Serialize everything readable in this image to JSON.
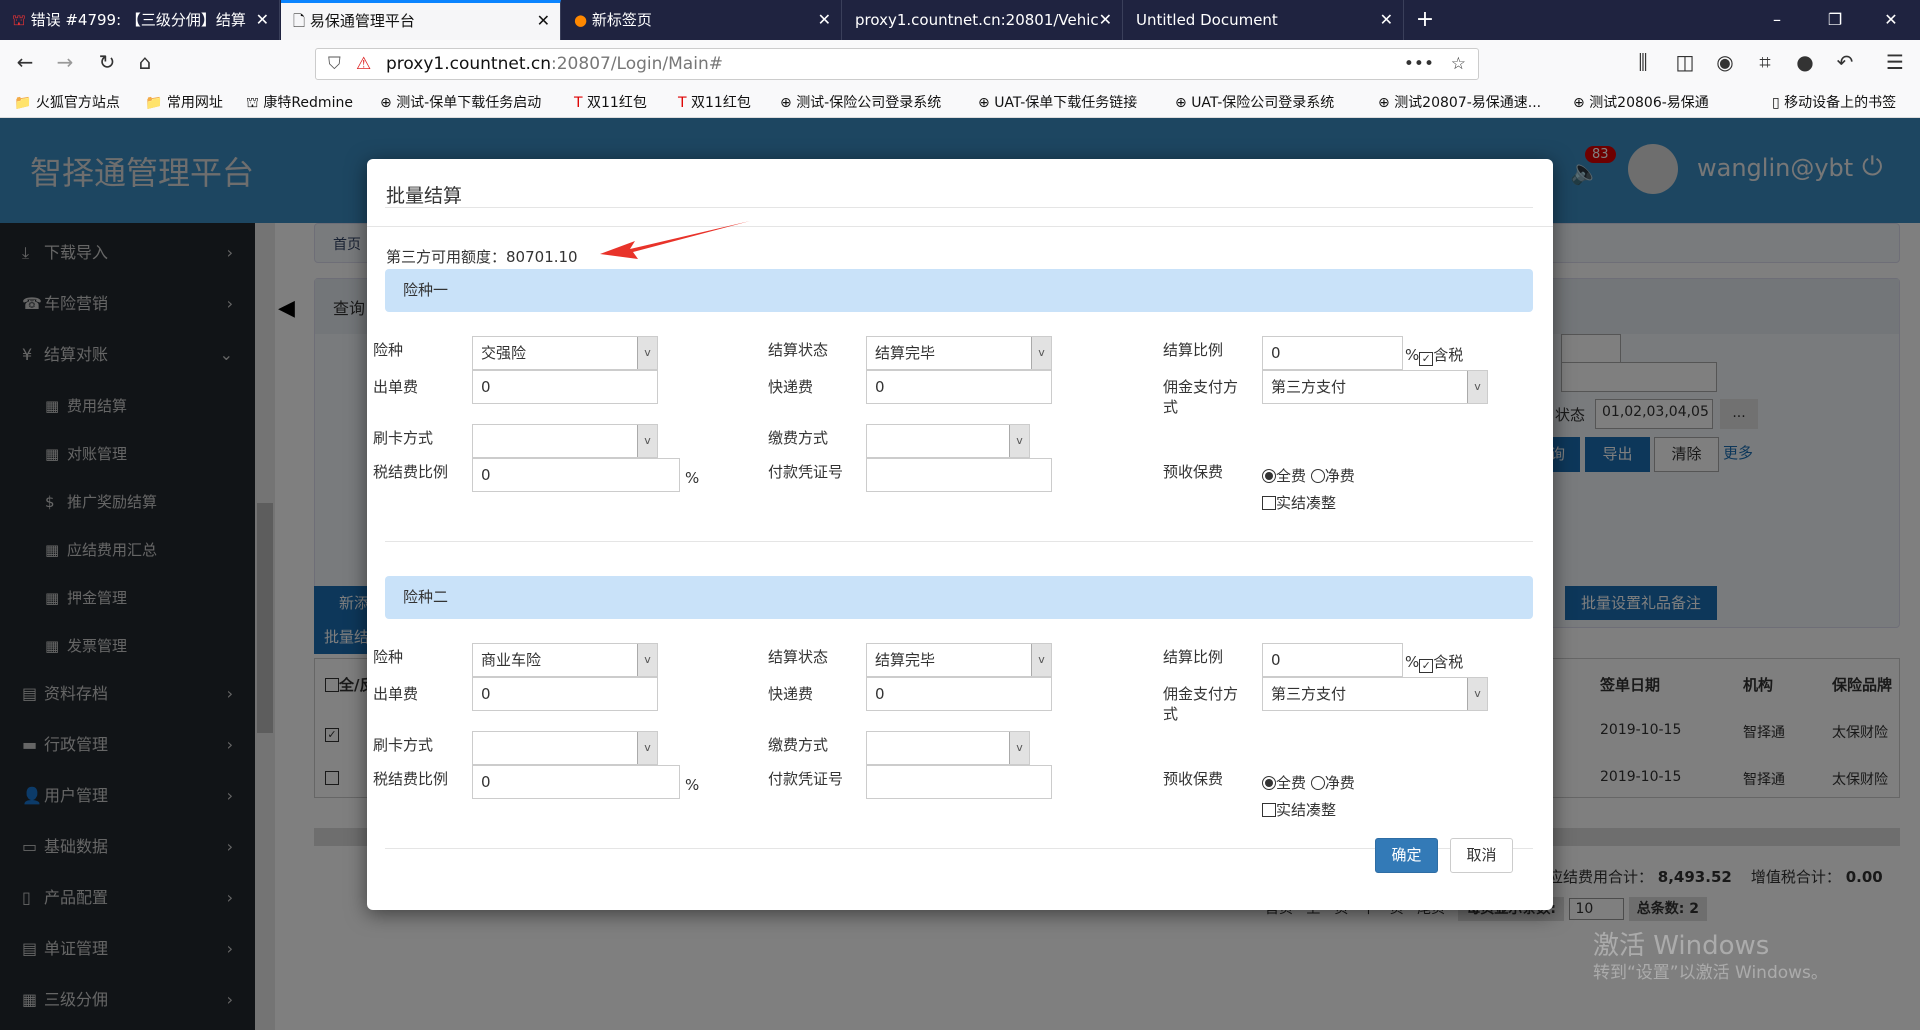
{
  "browser": {
    "tabs": [
      {
        "label": "错误 #4799: 【三级分佣】结算",
        "active": false
      },
      {
        "label": "易保通管理平台",
        "active": true
      },
      {
        "label": "新标签页",
        "active": false
      },
      {
        "label": "proxy1.countnet.cn:20801/Vehic",
        "active": false
      },
      {
        "label": "Untitled Document",
        "active": false
      }
    ],
    "url_host": "proxy1.countnet.cn",
    "url_rest": ":20807/Login/Main#",
    "bookmarks": [
      "火狐官方站点",
      "常用网址",
      "康特Redmine",
      "测试-保单下载任务启动",
      "双11红包",
      "双11红包",
      "测试-保险公司登录系统",
      "UAT-保单下载任务链接",
      "UAT-保险公司登录系统",
      "测试20807-易保通速...",
      "测试20806-易保通",
      "移动设备上的书签"
    ]
  },
  "header": {
    "title": "智择通管理平台",
    "notification_count": "83",
    "username": "wanglin@ybt"
  },
  "sidebar": {
    "items": [
      {
        "label": "下载导入",
        "icon": "download-icon"
      },
      {
        "label": "车险营销",
        "icon": "phone-icon"
      },
      {
        "label": "结算对账",
        "icon": "yen-icon",
        "expanded": true
      },
      {
        "label": "费用结算",
        "icon": "grid-icon",
        "sub": true
      },
      {
        "label": "对账管理",
        "icon": "grid-icon",
        "sub": true
      },
      {
        "label": "推广奖励结算",
        "icon": "dollar-icon",
        "sub": true
      },
      {
        "label": "应结费用汇总",
        "icon": "grid-icon",
        "sub": true
      },
      {
        "label": "押金管理",
        "icon": "grid-icon",
        "sub": true
      },
      {
        "label": "发票管理",
        "icon": "grid-icon",
        "sub": true
      },
      {
        "label": "资料存档",
        "icon": "list-icon"
      },
      {
        "label": "行政管理",
        "icon": "folder-icon"
      },
      {
        "label": "用户管理",
        "icon": "user-icon"
      },
      {
        "label": "基础数据",
        "icon": "drive-icon"
      },
      {
        "label": "产品配置",
        "icon": "book-icon"
      },
      {
        "label": "单证管理",
        "icon": "list-icon"
      },
      {
        "label": "三级分佣",
        "icon": "grid-icon"
      }
    ]
  },
  "background": {
    "breadcrumb": "首页",
    "query_title": "查询",
    "status_label": "状态",
    "status_value": "01,02,03,04,05",
    "ellipsis": "...",
    "query_btn": "查询",
    "export_btn": "导出",
    "clear_btn": "清除",
    "more_link": "更多",
    "add_btn": "新添",
    "batch_btn": "批量结算",
    "gift_btn": "批量设置礼品备注",
    "table_headers": [
      "全/反",
      "签单日期",
      "机构",
      "保险品牌"
    ],
    "rows": [
      {
        "checked": true,
        "date": "2019-10-15",
        "org": "智择通",
        "brand": "太保财险"
      },
      {
        "checked": false,
        "date": "2019-10-15",
        "org": "智择通",
        "brand": "太保财险"
      }
    ],
    "fee_total_label": "应结费用合计：",
    "fee_total": "8,493.52",
    "vat_total_label": "增值税合计：",
    "vat_total": "0.00",
    "pager": {
      "first": "首页",
      "prev": "上一页",
      "next": "下一页",
      "last": "尾页",
      "page_size_label": "每页显示条数:",
      "page_size": "10",
      "total": "总条数: 2"
    },
    "watermark1": "激活 Windows",
    "watermark2": "转到“设置”以激活 Windows。"
  },
  "modal": {
    "title": "批量结算",
    "credit_label": "第三方可用额度：",
    "credit_value": "80701.10",
    "sections": [
      {
        "title": "险种一",
        "insurance": "交强险",
        "settle_status": "结算完毕",
        "settle_ratio": "0",
        "tax_included": true,
        "issue_fee": "0",
        "express_fee": "0",
        "commission_pay": "第三方支付",
        "card_method": "",
        "pay_method": "",
        "tax_ratio": "0",
        "voucher": "",
        "prepay": "全费",
        "round": false
      },
      {
        "title": "险种二",
        "insurance": "商业车险",
        "settle_status": "结算完毕",
        "settle_ratio": "0",
        "tax_included": true,
        "issue_fee": "0",
        "express_fee": "0",
        "commission_pay": "第三方支付",
        "card_method": "",
        "pay_method": "",
        "tax_ratio": "0",
        "voucher": "",
        "prepay": "全费",
        "round": false
      }
    ],
    "labels": {
      "insurance": "险种",
      "settle_status": "结算状态",
      "settle_ratio": "结算比例",
      "percent": "%",
      "tax_included": "含税",
      "issue_fee": "出单费",
      "express_fee": "快递费",
      "commission_pay": "佣金支付方式",
      "card_method": "刷卡方式",
      "pay_method": "缴费方式",
      "tax_ratio": "税结费比例",
      "voucher": "付款凭证号",
      "prepay": "预收保费",
      "full": "全费",
      "net": "净费",
      "round": "实结凑整"
    },
    "ok": "确定",
    "cancel": "取消"
  },
  "colors": {
    "accent": "#337ab7",
    "section_bg": "#c9e2f9",
    "header_bg": "#3b8dc2",
    "arrow": "#e8332a"
  }
}
